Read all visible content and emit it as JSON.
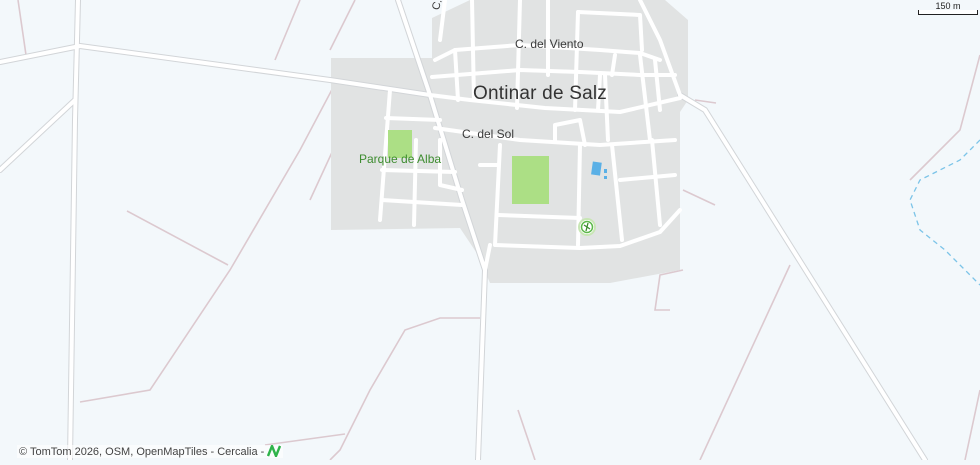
{
  "map": {
    "town_name": "Ontinar de Salz",
    "streets": {
      "viento": "C. del Viento",
      "sol": "C. del Sol",
      "vertical": "C. C"
    },
    "park_name": "Parque de Alba",
    "scale_label": "150 m",
    "attribution": "© TomTom 2026, OSM, OpenMapTiles - Cercalia -",
    "colors": {
      "background": "#f3f8fb",
      "urban": "#e1e3e3",
      "road": "#ffffff",
      "road_casing": "#d6d8da",
      "minor_road": "#dcc9cf",
      "park": "#acdf85",
      "water": "#5ab0e6",
      "logo": "#2fb34a"
    }
  }
}
